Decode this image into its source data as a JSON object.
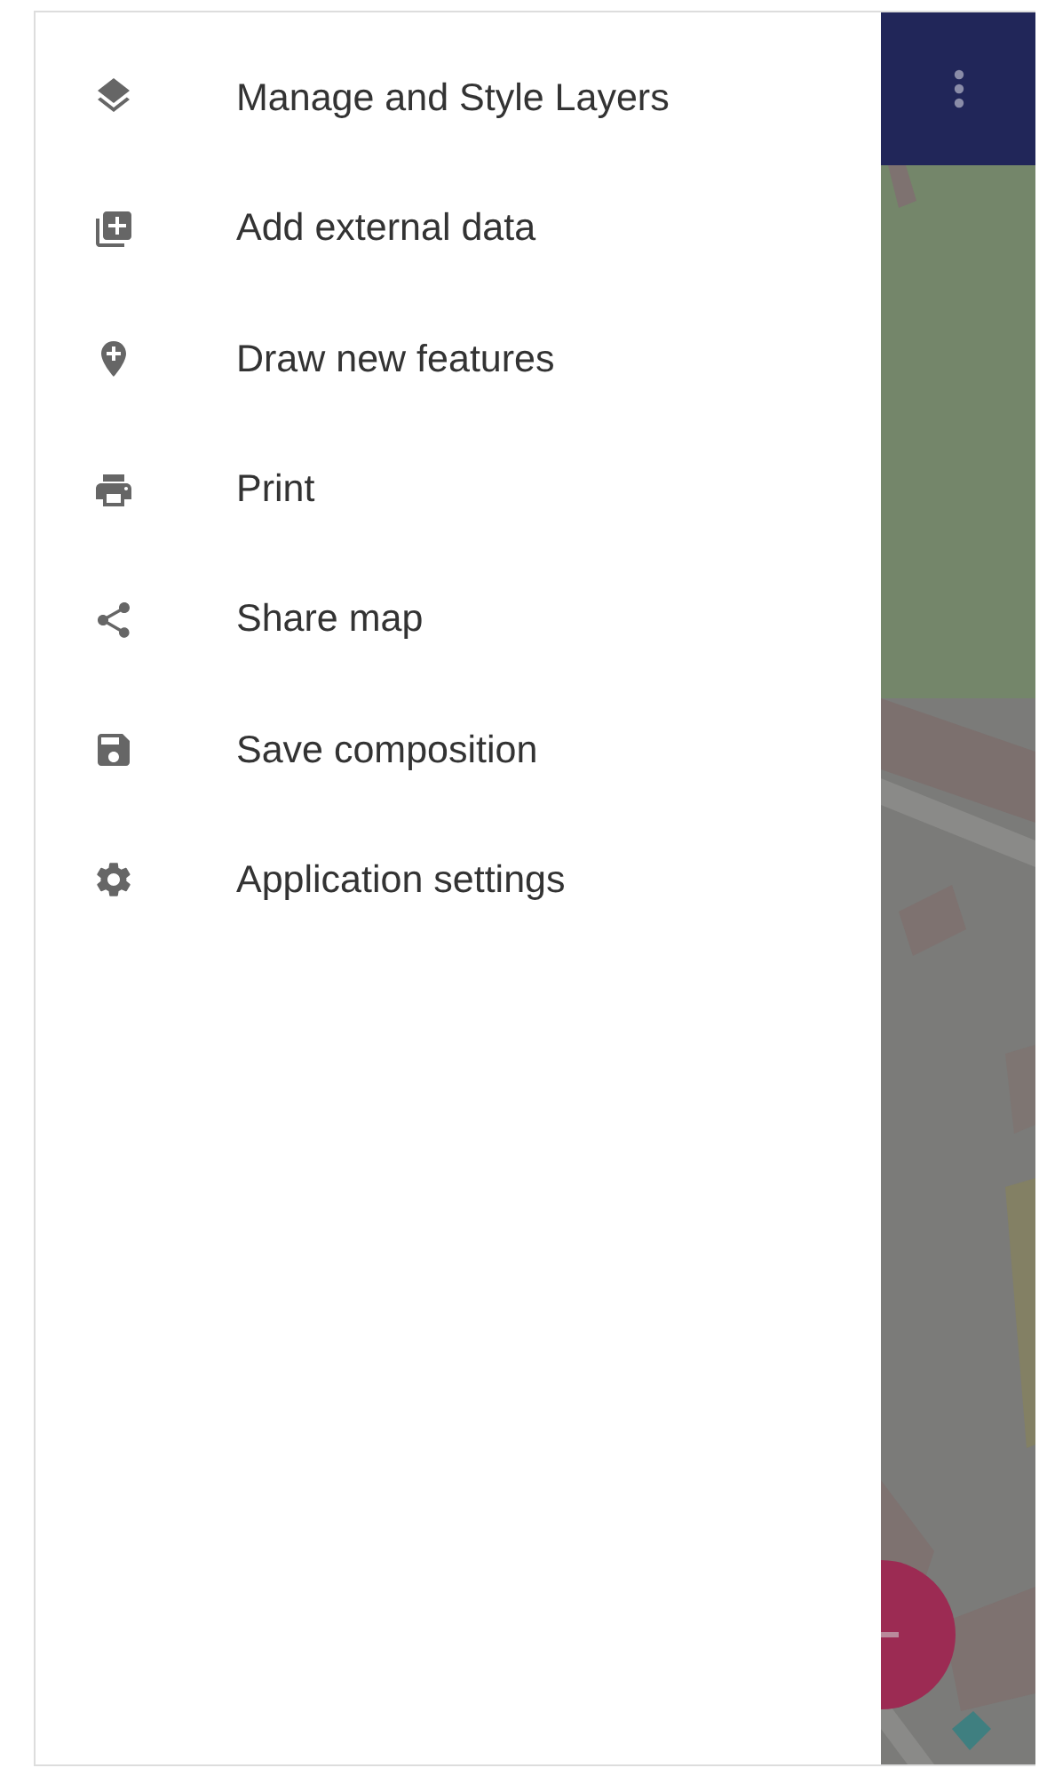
{
  "menu": {
    "items": [
      {
        "label": "Manage and Style Layers"
      },
      {
        "label": "Add external data"
      },
      {
        "label": "Draw new features"
      },
      {
        "label": "Print"
      },
      {
        "label": "Share map"
      },
      {
        "label": "Save composition"
      },
      {
        "label": "Application settings"
      }
    ]
  }
}
